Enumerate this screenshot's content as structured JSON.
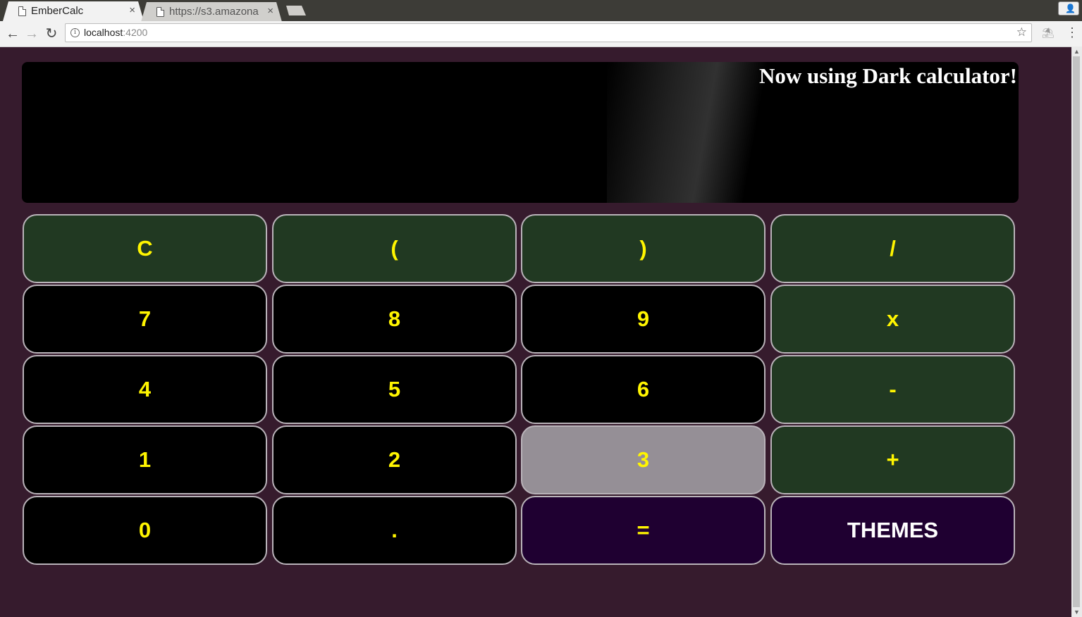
{
  "browser": {
    "tabs": [
      {
        "title": "EmberCalc",
        "close": "×",
        "active": true
      },
      {
        "title": "https://s3.amazona",
        "close": "×",
        "active": false
      }
    ],
    "url_host": "localhost",
    "url_port": ":4200",
    "nav": {
      "back": "←",
      "forward": "→",
      "reload": "↻"
    },
    "star": "☆",
    "menu": "⋮",
    "profile": "👤"
  },
  "display": {
    "message": "Now using Dark calculator!"
  },
  "keys": {
    "clear": "C",
    "lparen": "(",
    "rparen": ")",
    "divide": "/",
    "seven": "7",
    "eight": "8",
    "nine": "9",
    "multiply": "x",
    "four": "4",
    "five": "5",
    "six": "6",
    "subtract": "-",
    "one": "1",
    "two": "2",
    "three": "3",
    "add": "+",
    "zero": "0",
    "decimal": ".",
    "equals": "=",
    "themes": "THEMES"
  },
  "colors": {
    "page_bg": "#361b2d",
    "key_operator": "#213922",
    "key_digit": "#000000",
    "key_pressed": "#958f96",
    "key_action": "#1f0031",
    "key_text": "#fff500"
  }
}
